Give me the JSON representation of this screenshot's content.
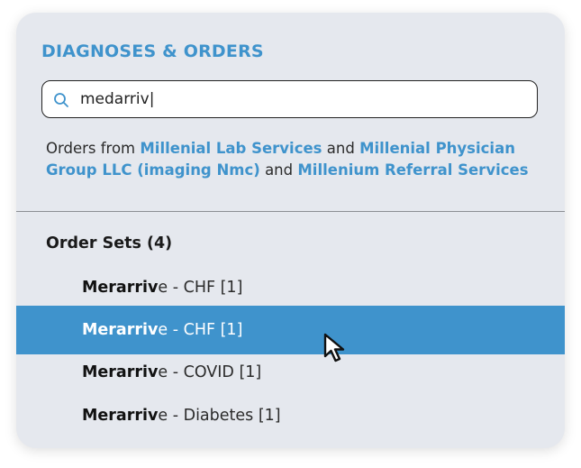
{
  "section": {
    "title": "DIAGNOSES & ORDERS"
  },
  "search": {
    "value": "medarriv|",
    "icon": "search-icon"
  },
  "orders_from": {
    "prefix": "Orders from ",
    "source_1": "Millenial Lab Services",
    "joiner_1": " and ",
    "source_2": "Millenial Physician Group LLC (imaging Nmc)",
    "joiner_2": " and ",
    "source_3": "Millenium Referral Services"
  },
  "order_sets": {
    "header": "Order Sets (4)",
    "items": [
      {
        "match": "Merarriv",
        "rest": "e - CHF [1]",
        "selected": false
      },
      {
        "match": "Merarriv",
        "rest": "e - CHF [1]",
        "selected": true
      },
      {
        "match": "Merarriv",
        "rest": "e - COVID [1]",
        "selected": false
      },
      {
        "match": "Merarriv",
        "rest": "e - Diabetes [1]",
        "selected": false
      }
    ]
  },
  "colors": {
    "accent": "#3f93cc",
    "panel_bg": "#e5e8ee",
    "text": "#2b2b2b"
  }
}
